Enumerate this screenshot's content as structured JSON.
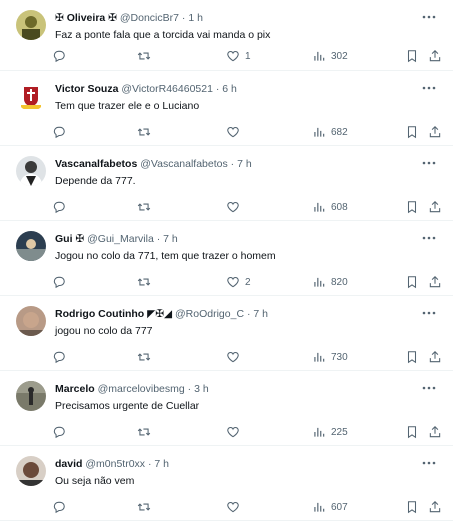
{
  "tweets": [
    {
      "name": "✠ Oliveira ✠",
      "handle": "@DoncicBr7",
      "time": "1 h",
      "text": "Faz a ponte fala que a torcida vai manda o pix",
      "replies": "",
      "retweets": "",
      "likes": "1",
      "views": "302",
      "avatar_color": "#7a7a2a"
    },
    {
      "name": "Victor Souza",
      "handle": "@VictorR46460521",
      "time": "6 h",
      "text": "Tem que trazer ele e o Luciano",
      "replies": "",
      "retweets": "",
      "likes": "",
      "views": "682",
      "avatar_color": "#b01d24"
    },
    {
      "name": "Vascanalfabetos",
      "handle": "@Vascanalfabetos",
      "time": "7 h",
      "text": "Depende da 777.",
      "replies": "",
      "retweets": "",
      "likes": "",
      "views": "608",
      "avatar_color": "#3a3a3a"
    },
    {
      "name": "Gui ✠",
      "handle": "@Gui_Marvila",
      "time": "7 h",
      "text": "Jogou no colo da 771, tem que trazer o homem",
      "replies": "",
      "retweets": "",
      "likes": "2",
      "views": "820",
      "avatar_color": "#2c3e50"
    },
    {
      "name": "Rodrigo Coutinho ◤✠◢",
      "handle": "@RoOdrigo_C",
      "time": "7 h",
      "text": "jogou no colo da 777",
      "replies": "",
      "retweets": "",
      "likes": "",
      "views": "730",
      "avatar_color": "#8a6a55"
    },
    {
      "name": "Marcelo",
      "handle": "@marcelovibesmg",
      "time": "3 h",
      "text": "Precisamos urgente de Cuellar",
      "replies": "",
      "retweets": "",
      "likes": "",
      "views": "225",
      "avatar_color": "#5a5a4a"
    },
    {
      "name": "david",
      "handle": "@m0n5tr0xx",
      "time": "7 h",
      "text": "Ou seja não vem",
      "replies": "",
      "retweets": "",
      "likes": "",
      "views": "607",
      "avatar_color": "#6b4a3a"
    }
  ],
  "separator": "·",
  "icons": {
    "reply": "reply-icon",
    "retweet": "retweet-icon",
    "like": "heart-icon",
    "views": "views-icon",
    "bookmark": "bookmark-icon",
    "share": "share-icon",
    "more": "more-icon"
  },
  "colors": {
    "text": "#0f1419",
    "muted": "#536471",
    "border": "#eff3f4"
  }
}
